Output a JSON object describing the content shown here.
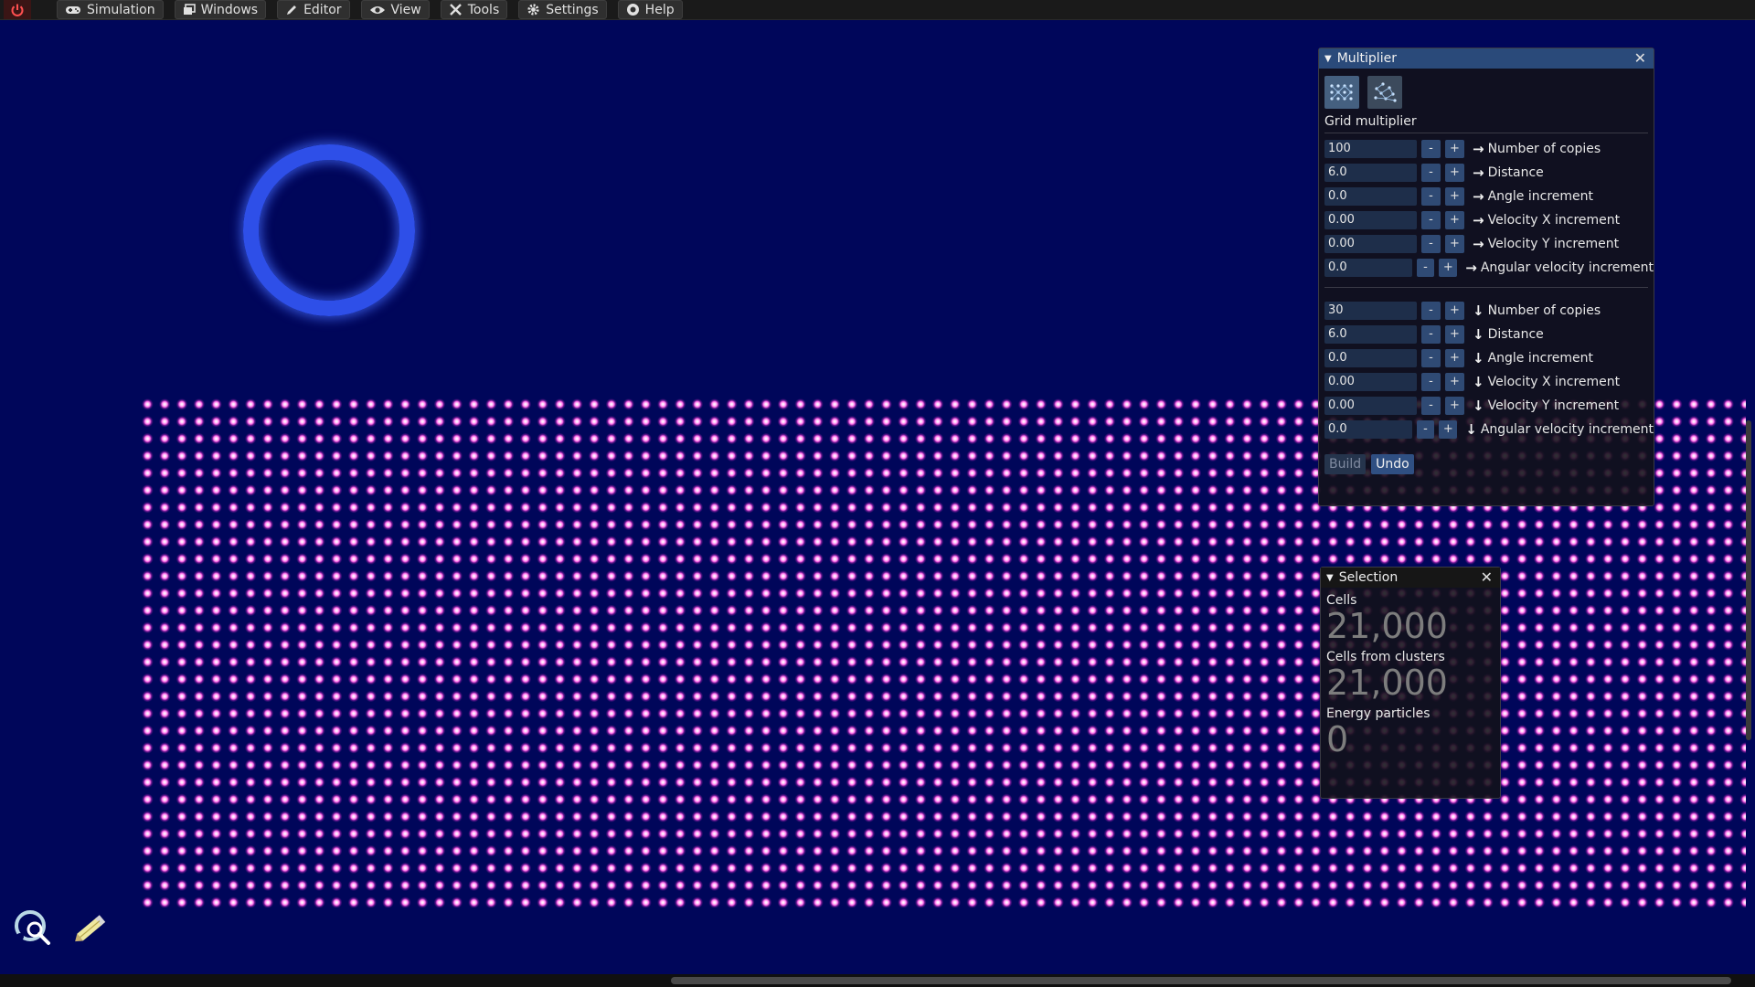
{
  "menu": {
    "items": [
      {
        "label": "Simulation",
        "icon": "gamepad-icon"
      },
      {
        "label": "Windows",
        "icon": "windows-icon"
      },
      {
        "label": "Editor",
        "icon": "pencil-icon"
      },
      {
        "label": "View",
        "icon": "eye-icon"
      },
      {
        "label": "Tools",
        "icon": "tools-icon"
      },
      {
        "label": "Settings",
        "icon": "gear-icon"
      },
      {
        "label": "Help",
        "icon": "help-icon"
      }
    ]
  },
  "multiplier": {
    "title": "Multiplier",
    "section_label": "Grid multiplier",
    "horizontal": [
      {
        "value": "100",
        "label": "Number of copies"
      },
      {
        "value": "6.0",
        "label": "Distance"
      },
      {
        "value": "0.0",
        "label": "Angle increment"
      },
      {
        "value": "0.00",
        "label": "Velocity X increment"
      },
      {
        "value": "0.00",
        "label": "Velocity Y increment"
      },
      {
        "value": "0.0",
        "label": "Angular velocity increment"
      }
    ],
    "vertical": [
      {
        "value": "30",
        "label": "Number of copies"
      },
      {
        "value": "6.0",
        "label": "Distance"
      },
      {
        "value": "0.0",
        "label": "Angle increment"
      },
      {
        "value": "0.00",
        "label": "Velocity X increment"
      },
      {
        "value": "0.00",
        "label": "Velocity Y increment"
      },
      {
        "value": "0.0",
        "label": "Angular velocity increment"
      }
    ],
    "minus": "-",
    "plus": "+",
    "arrow_right": "→",
    "arrow_down": "↓",
    "build_label": "Build",
    "undo_label": "Undo"
  },
  "selection": {
    "title": "Selection",
    "cells_label": "Cells",
    "cells_value": "21,000",
    "cluster_cells_label": "Cells from clusters",
    "cluster_cells_value": "21,000",
    "energy_label": "Energy particles",
    "energy_value": "0"
  },
  "colors": {
    "background": "#00065a",
    "ring": "#2e4fe8",
    "particles": "#ff6fe9",
    "title_bar": "#2a4a7a"
  }
}
